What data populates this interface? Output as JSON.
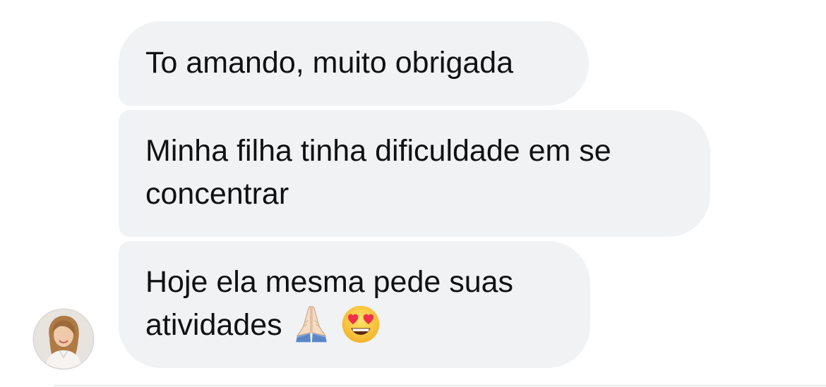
{
  "conversation": {
    "messages": [
      {
        "lines": [
          "To amando, muito obrigada"
        ]
      },
      {
        "lines": [
          "Minha filha tinha dificuldade em se",
          "concentrar"
        ]
      },
      {
        "lines": [
          "Hoje ela mesma pede suas",
          "atividades"
        ],
        "emojis": [
          "folded-hands-icon",
          "heart-eyes-icon"
        ]
      }
    ],
    "sender": {
      "avatar": "avatar-photo"
    }
  },
  "colors": {
    "bubble_bg": "#f1f2f4",
    "text": "#111111",
    "background": "#ffffff"
  }
}
